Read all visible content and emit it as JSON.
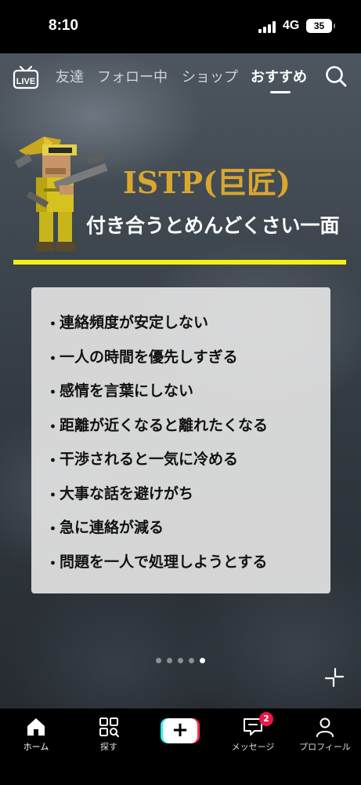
{
  "status_bar": {
    "time": "8:10",
    "network": "4G",
    "battery": "35"
  },
  "top_nav": {
    "live_label": "LIVE",
    "tabs": [
      {
        "label": "友達"
      },
      {
        "label": "フォロー中"
      },
      {
        "label": "ショップ"
      },
      {
        "label": "おすすめ"
      }
    ],
    "active_tab": "おすすめ"
  },
  "post": {
    "title": "ISTP(巨匠)",
    "subtitle": "付き合うとめんどくさい一面",
    "bullet": "・",
    "items": [
      "連絡頻度が安定しない",
      "一人の時間を優先しすぎる",
      "感情を言葉にしない",
      "距離が近くなると離れたくなる",
      "干渉されると一気に冷める",
      "大事な話を避けがち",
      "急に連絡が減る",
      "問題を一人で処理しようとする"
    ],
    "carousel": {
      "total": 5,
      "current": 5
    },
    "colors": {
      "title": "#d9a72e",
      "underline": "#f3ee14"
    }
  },
  "bottom_nav": {
    "home": "ホーム",
    "discover": "探す",
    "create": "+",
    "inbox": "メッセージ",
    "inbox_badge": "2",
    "profile": "プロフィール"
  }
}
